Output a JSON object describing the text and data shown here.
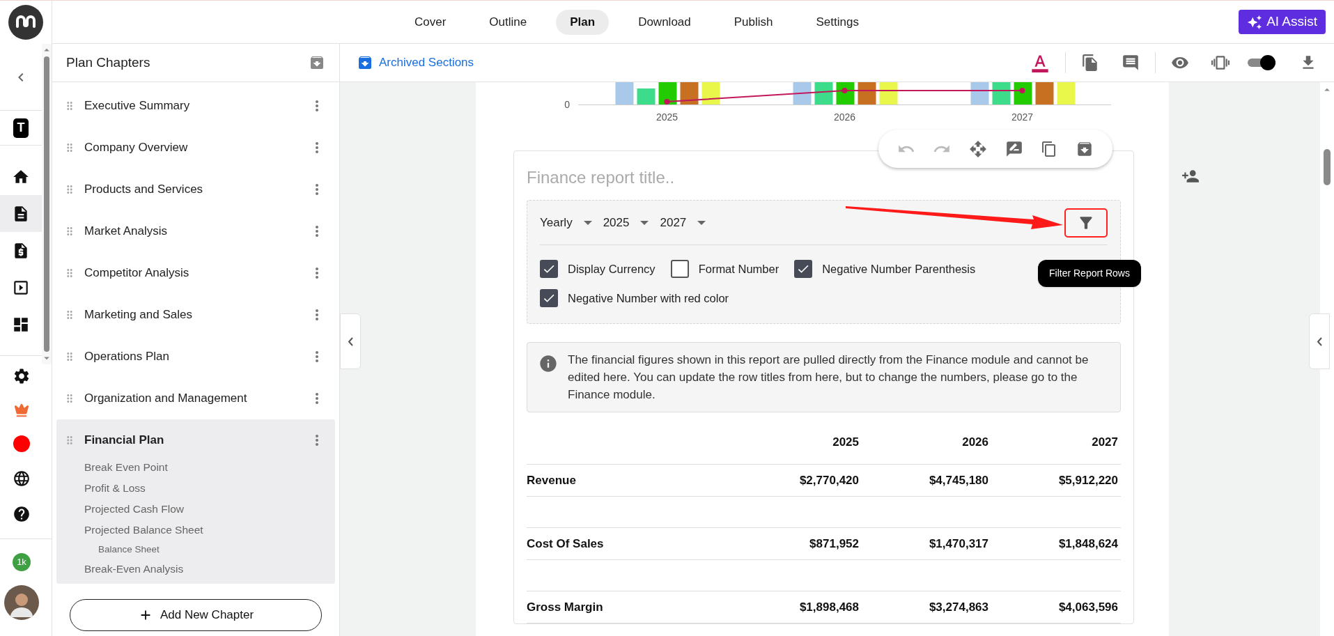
{
  "nav_tabs": [
    {
      "label": "Cover",
      "selected": false
    },
    {
      "label": "Outline",
      "selected": false
    },
    {
      "label": "Plan",
      "selected": true
    },
    {
      "label": "Download",
      "selected": false
    },
    {
      "label": "Publish",
      "selected": false
    },
    {
      "label": "Settings",
      "selected": false
    }
  ],
  "ai_button": "AI Assist",
  "rail": {
    "workspace_letter": "T",
    "badge": "1k",
    "items": [
      {
        "kind": "home",
        "selected": false
      },
      {
        "kind": "document",
        "selected": true
      },
      {
        "kind": "quote",
        "selected": false
      },
      {
        "kind": "presentation",
        "selected": false
      },
      {
        "kind": "dashboard",
        "selected": false
      }
    ],
    "bottom_items": [
      {
        "kind": "settings"
      },
      {
        "kind": "crown"
      },
      {
        "kind": "record"
      },
      {
        "kind": "globe"
      },
      {
        "kind": "help"
      }
    ]
  },
  "sidebar": {
    "title": "Plan Chapters",
    "chapters": [
      {
        "label": "Executive Summary",
        "selected": false
      },
      {
        "label": "Company Overview",
        "selected": false
      },
      {
        "label": "Products and Services",
        "selected": false
      },
      {
        "label": "Market Analysis",
        "selected": false
      },
      {
        "label": "Competitor Analysis",
        "selected": false
      },
      {
        "label": "Marketing and Sales",
        "selected": false
      },
      {
        "label": "Operations Plan",
        "selected": false
      },
      {
        "label": "Organization and Management",
        "selected": false
      },
      {
        "label": "Financial Plan",
        "selected": true,
        "children": [
          {
            "label": "Break Even Point"
          },
          {
            "label": "Profit & Loss"
          },
          {
            "label": "Projected Cash Flow"
          },
          {
            "label": "Projected Balance Sheet",
            "children": [
              {
                "label": "Balance Sheet"
              }
            ]
          },
          {
            "label": "Break-Even Analysis"
          }
        ]
      }
    ],
    "add_button": "Add New Chapter"
  },
  "toolbar": {
    "archived_link": "Archived Sections",
    "preview_toggle_on": true
  },
  "chart": {
    "y_tick": "0",
    "categories": [
      "2025",
      "2026",
      "2027"
    ]
  },
  "report": {
    "title_placeholder": "Finance report title..",
    "selects": [
      "Yearly",
      "2025",
      "2027"
    ],
    "options": [
      {
        "label": "Display Currency",
        "checked": true
      },
      {
        "label": "Format Number",
        "checked": false
      },
      {
        "label": "Negative Number Parenthesis",
        "checked": true
      },
      {
        "label": "Negative Number with red color",
        "checked": true
      }
    ],
    "tooltip": "Filter Report Rows",
    "info": "The financial figures shown in this report are pulled directly from the Finance module and cannot be edited here. You can update the row titles from here, but to change the numbers, please go to the Finance module.",
    "columns": [
      "2025",
      "2026",
      "2027"
    ],
    "rows": [
      {
        "label": "Revenue",
        "values": [
          "$2,770,420",
          "$4,745,180",
          "$5,912,220"
        ]
      },
      {
        "label": "Cost Of Sales",
        "values": [
          "$871,952",
          "$1,470,317",
          "$1,848,624"
        ]
      },
      {
        "label": "Gross Margin",
        "values": [
          "$1,898,468",
          "$3,274,863",
          "$4,063,596"
        ]
      }
    ]
  }
}
